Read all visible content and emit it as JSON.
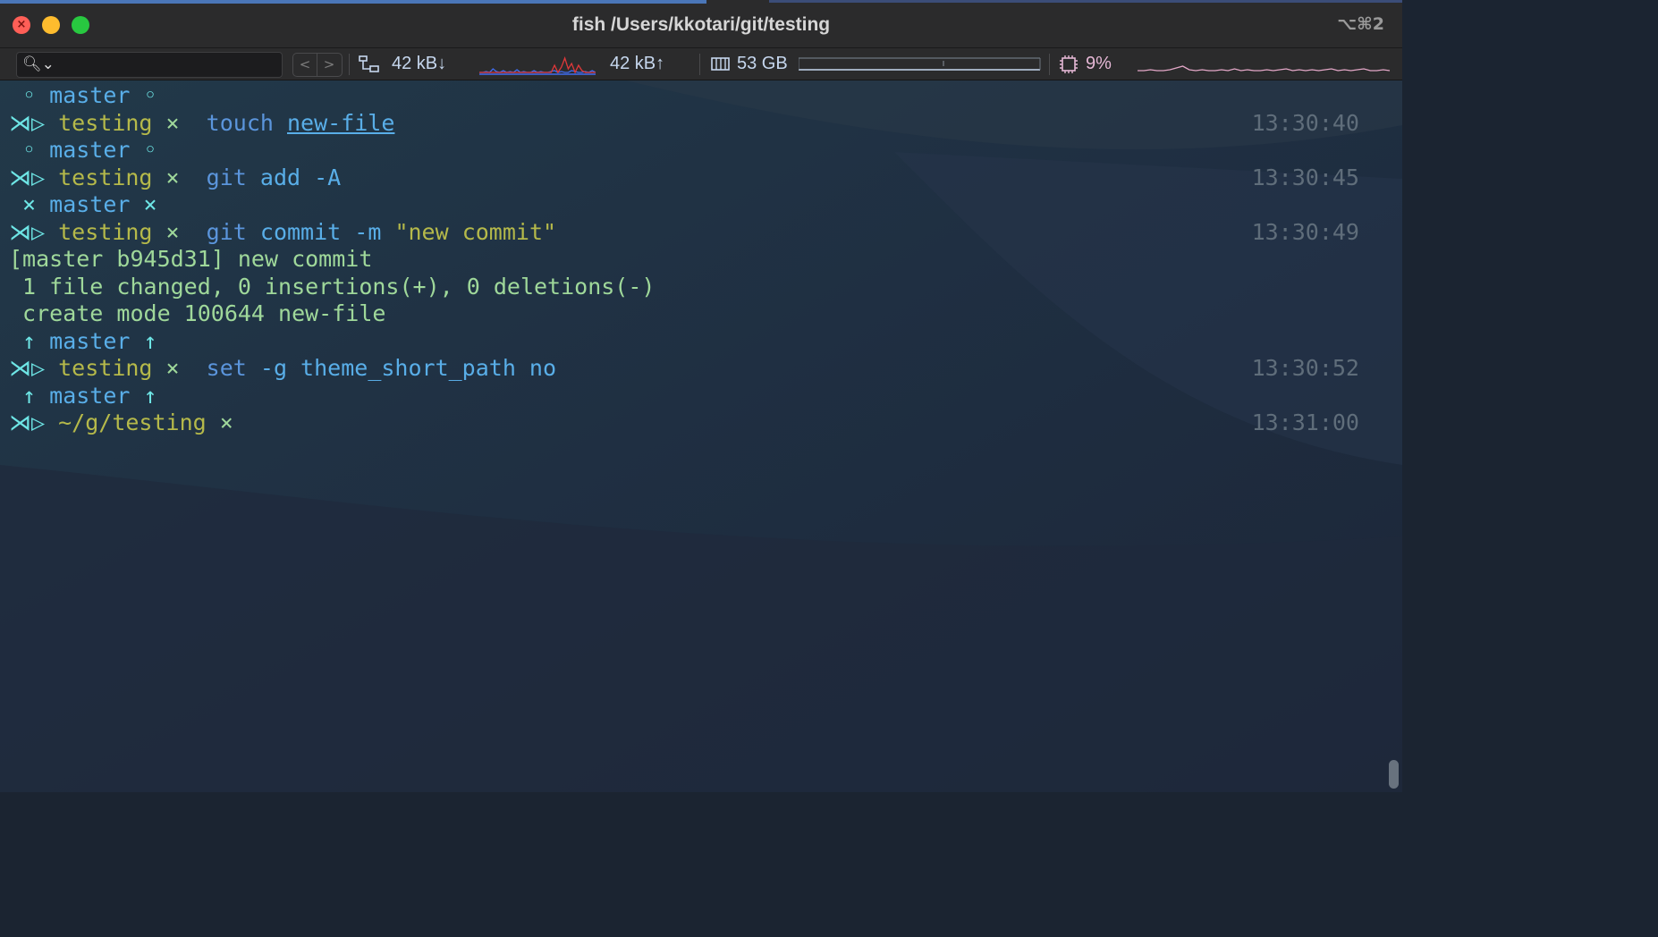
{
  "window": {
    "title": "fish /Users/kkotari/git/testing",
    "shortcut": "⌥⌘2",
    "close_glyph": "×"
  },
  "statusbar": {
    "search_icon_glyph": "🔍︎⌄",
    "nav_back_glyph": "<",
    "nav_forward_glyph": ">",
    "net_down": "42 kB↓",
    "net_up": "42 kB↑",
    "memory": "53 GB",
    "cpu": "9%",
    "colors": {
      "net_down_spark": "#3f6cf0",
      "net_up_spark": "#e0383a",
      "cpu_spark": "#e3a7c7"
    }
  },
  "terminal": {
    "lines": [
      {
        "marker": " ◦ ",
        "branch": "master",
        "suffix": " ◦"
      },
      {
        "marker": "⋊▷ ",
        "dir": "testing",
        "status": " × ",
        "cmd": "touch",
        "args": [
          {
            "text": "new-file",
            "underline": true
          }
        ],
        "time": "13:30:40"
      },
      {
        "marker": " ◦ ",
        "branch": "master",
        "suffix": " ◦"
      },
      {
        "marker": "⋊▷ ",
        "dir": "testing",
        "status": " × ",
        "cmd": "git",
        "args": [
          {
            "text": "add -A"
          }
        ],
        "time": "13:30:45"
      },
      {
        "marker": " × ",
        "branch": "master",
        "suffix": " ×"
      },
      {
        "marker": "⋊▷ ",
        "dir": "testing",
        "status": " × ",
        "cmd": "git",
        "args": [
          {
            "text": "commit -m"
          },
          {
            "text": "\"new commit\"",
            "string": true
          }
        ],
        "time": "13:30:49"
      },
      {
        "output": "[master b945d31] new commit"
      },
      {
        "output": " 1 file changed, 0 insertions(+), 0 deletions(-)"
      },
      {
        "output": " create mode 100644 new-file"
      },
      {
        "marker": " ↑ ",
        "branch": "master",
        "suffix": " ↑"
      },
      {
        "marker": "⋊▷ ",
        "dir": "testing",
        "status": " × ",
        "cmd": "set",
        "args": [
          {
            "text": "-g theme_short_path no"
          }
        ],
        "time": "13:30:52"
      },
      {
        "marker": " ↑ ",
        "branch": "master",
        "suffix": " ↑"
      },
      {
        "marker": "⋊▷ ",
        "dir": "~/g/testing",
        "status": " ×",
        "time": "13:31:00"
      }
    ]
  }
}
